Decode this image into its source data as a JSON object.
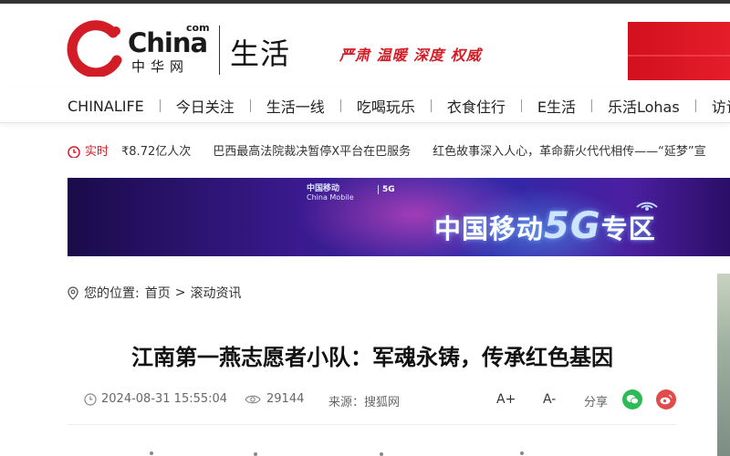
{
  "logo": {
    "wordmark": "China",
    "com": "com",
    "cn_text": "中华网"
  },
  "header": {
    "channel": "生活",
    "slogan": "严肃 温暖 深度 权威"
  },
  "nav": {
    "items": [
      "CHINALIFE",
      "今日关注",
      "生活一线",
      "吃喝玩乐",
      "衣食住行",
      "E生活",
      "乐活Lohas",
      "访谈"
    ]
  },
  "ticker": {
    "live_label": "实时",
    "items": [
      "₹8.72亿人次",
      "巴西最高法院裁决暂停X平台在巴服务",
      "红色故事深入人心，革命薪火代代相传——“延梦”宣"
    ]
  },
  "banner": {
    "brand_cn": "中国移动",
    "brand_en": "China Mobile",
    "tag": "5G",
    "zone_prefix": "中国移动",
    "zone_big": "5G",
    "zone_suffix": "专区"
  },
  "breadcrumb": {
    "label": "您的位置:",
    "home": "首页",
    "separator": ">",
    "current": "滚动资讯"
  },
  "article": {
    "title": "江南第一燕志愿者小队：军魂永铸，传承红色基因",
    "date": "2024-08-31 15:55:04",
    "views": "29144",
    "source": "来源：搜狐网",
    "font_larger": "A+",
    "font_smaller": "A-",
    "share_label": "分享"
  },
  "colors": {
    "brand_red": "#d31d26",
    "wechat_green": "#2dbb55",
    "weibo_red": "#e24b4b"
  }
}
